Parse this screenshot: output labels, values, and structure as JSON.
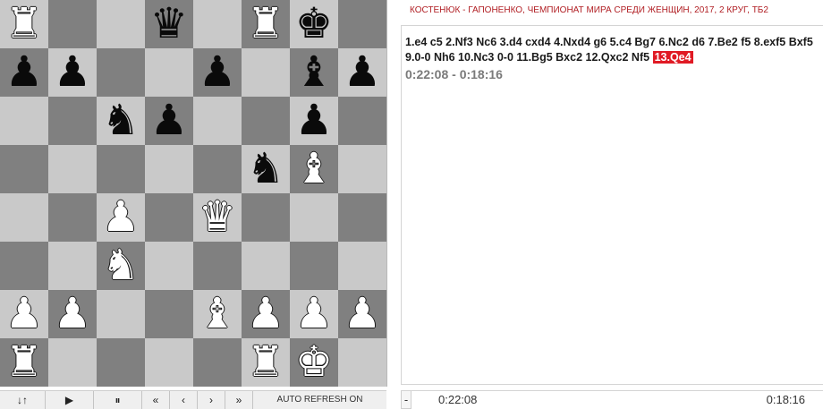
{
  "board": {
    "ranks": [
      [
        {
          "t": "r",
          "c": "w"
        },
        null,
        null,
        {
          "t": "q",
          "c": "b"
        },
        null,
        {
          "t": "r",
          "c": "w"
        },
        {
          "t": "k",
          "c": "b"
        },
        null
      ],
      [
        {
          "t": "p",
          "c": "b"
        },
        {
          "t": "p",
          "c": "b"
        },
        null,
        null,
        {
          "t": "p",
          "c": "b"
        },
        null,
        {
          "t": "b",
          "c": "b"
        },
        {
          "t": "p",
          "c": "b"
        }
      ],
      [
        null,
        null,
        {
          "t": "n",
          "c": "b"
        },
        {
          "t": "p",
          "c": "b"
        },
        null,
        null,
        {
          "t": "p",
          "c": "b"
        },
        null
      ],
      [
        null,
        null,
        null,
        null,
        null,
        {
          "t": "n",
          "c": "b"
        },
        {
          "t": "b",
          "c": "w"
        },
        null
      ],
      [
        null,
        null,
        {
          "t": "p",
          "c": "w"
        },
        null,
        {
          "t": "q",
          "c": "w"
        },
        null,
        null,
        null
      ],
      [
        null,
        null,
        {
          "t": "n",
          "c": "w"
        },
        null,
        null,
        null,
        null,
        null
      ],
      [
        {
          "t": "p",
          "c": "w"
        },
        {
          "t": "p",
          "c": "w"
        },
        null,
        null,
        {
          "t": "b",
          "c": "w"
        },
        {
          "t": "p",
          "c": "w"
        },
        {
          "t": "p",
          "c": "w"
        },
        {
          "t": "p",
          "c": "w"
        }
      ],
      [
        {
          "t": "r",
          "c": "w"
        },
        null,
        null,
        null,
        null,
        {
          "t": "r",
          "c": "w"
        },
        {
          "t": "k",
          "c": "w"
        },
        null
      ]
    ]
  },
  "controls": {
    "flip": "↓↑",
    "play": "▶",
    "pause": "⏸",
    "first": "«",
    "prev": "‹",
    "next": "›",
    "last": "»",
    "auto_refresh": "AUTO REFRESH ON"
  },
  "game": {
    "title": "КОСТЕНЮК - ГАПОНЕНКО, ЧЕМПИОНАТ МИРА СРЕДИ ЖЕНЩИН, 2017, 2 КРУГ, ТБ2",
    "moves": "1.e4 c5 2.Nf3 Nc6 3.d4 cxd4 4.Nxd4 g6 5.c4 Bg7 6.Nc2 d6 7.Be2 f5 8.exf5 Bxf5 9.0-0 Nh6 10.Nc3 0-0 11.Bg5 Bxc2 12.Qxc2 Nf5",
    "current_move": "13.Qe4",
    "clock_line": "0:22:08 - 0:18:16"
  },
  "bottom": {
    "dash": "-",
    "white_clock": "0:22:08",
    "black_clock": "0:18:16"
  },
  "colors": {
    "light_square": "#c9c9c9",
    "dark_square": "#808080",
    "title": "#b11f24",
    "current_move_bg": "#e01a24"
  }
}
